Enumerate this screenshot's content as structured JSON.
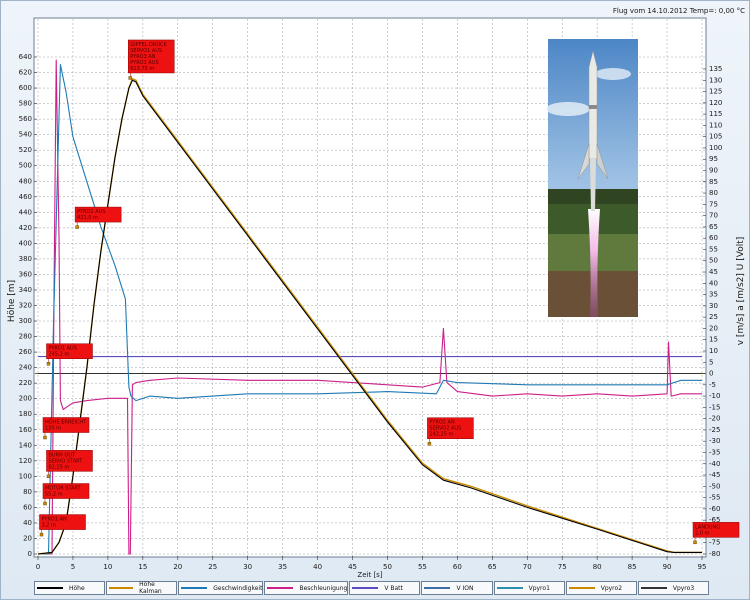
{
  "header": {
    "flight_info": "Flug vom 14.10.2012 Temp=: 0,00 °C"
  },
  "chart_data": {
    "type": "line",
    "xlabel": "Zeit [s]",
    "ylabel_left": "Höhe [m]",
    "ylabel_right": "v [m/s]  a [m/s2]  U [Volt]",
    "xlim": [
      0,
      95
    ],
    "x_ticks": [
      0,
      5,
      10,
      15,
      20,
      25,
      30,
      35,
      40,
      45,
      50,
      55,
      60,
      65,
      70,
      75,
      80,
      85,
      90,
      95
    ],
    "ylim_left": [
      0,
      640
    ],
    "y_ticks_left": [
      0,
      20,
      40,
      60,
      80,
      100,
      120,
      140,
      160,
      180,
      200,
      220,
      240,
      260,
      280,
      300,
      320,
      340,
      360,
      380,
      400,
      420,
      440,
      460,
      480,
      500,
      520,
      540,
      560,
      580,
      600,
      620,
      640
    ],
    "ylim_right": [
      -80,
      135
    ],
    "y_ticks_right": [
      -80,
      -75,
      -70,
      -65,
      -60,
      -55,
      -50,
      -45,
      -40,
      -35,
      -30,
      -25,
      -20,
      -15,
      -10,
      -5,
      0,
      5,
      10,
      15,
      20,
      25,
      30,
      35,
      40,
      45,
      50,
      55,
      60,
      65,
      70,
      75,
      80,
      85,
      90,
      95,
      100,
      105,
      110,
      115,
      120,
      125,
      130,
      135
    ],
    "grid": true,
    "legend_position": "bottom",
    "series": [
      {
        "name": "Höhe",
        "color": "#000000",
        "axis": "left",
        "x": [
          0,
          2,
          3,
          4,
          5,
          6,
          7,
          8,
          9,
          10,
          11,
          12,
          13,
          13.5,
          14,
          15,
          20,
          30,
          40,
          50,
          55,
          58,
          62,
          70,
          80,
          90,
          91,
          92,
          95
        ],
        "y": [
          0,
          2,
          15,
          40,
          100,
          170,
          240,
          320,
          390,
          450,
          510,
          560,
          600,
          610,
          608,
          590,
          530,
          410,
          290,
          170,
          115,
          95,
          85,
          60,
          32,
          3,
          2,
          2,
          2
        ]
      },
      {
        "name": "Höhe Kalman",
        "color": "#c98a00",
        "axis": "left",
        "x": [
          0,
          2,
          3,
          4,
          5,
          6,
          7,
          8,
          9,
          10,
          11,
          12,
          13,
          13.5,
          14,
          15,
          20,
          30,
          40,
          50,
          55,
          58,
          62,
          70,
          80,
          90,
          91,
          92,
          95
        ],
        "y": [
          0,
          2,
          15,
          40,
          100,
          170,
          240,
          320,
          390,
          450,
          510,
          560,
          600,
          612,
          610,
          592,
          532,
          412,
          292,
          172,
          117,
          97,
          87,
          62,
          33,
          4,
          2,
          2,
          2
        ]
      },
      {
        "name": "Geschwindigkeit",
        "color": "#1f7ab5",
        "axis": "right",
        "x": [
          0,
          1.5,
          2.2,
          3.2,
          4,
          5,
          7,
          9,
          11,
          12.5,
          13,
          13.3,
          14,
          16,
          20,
          30,
          40,
          50,
          57,
          58,
          60,
          70,
          80,
          90,
          92,
          95
        ],
        "y": [
          -80,
          -80,
          20,
          137,
          125,
          105,
          85,
          65,
          48,
          33,
          -6,
          -10,
          -12,
          -10,
          -11,
          -9,
          -9,
          -8,
          -9,
          -3,
          -4,
          -5,
          -5,
          -5,
          -3,
          -3
        ]
      },
      {
        "name": "Beschleunigung",
        "color": "#cc1f8a",
        "axis": "right",
        "x": [
          0,
          2,
          2.3,
          2.6,
          3,
          3.2,
          3.6,
          4,
          5,
          7,
          10,
          12.8,
          13,
          13.2,
          13.5,
          14,
          16,
          20,
          30,
          40,
          50,
          55,
          57.5,
          58,
          58.5,
          60,
          65,
          70,
          75,
          80,
          85,
          90,
          90.2,
          90.6,
          92,
          95
        ],
        "y": [
          -80,
          -80,
          40,
          139,
          60,
          -12,
          -16,
          -15,
          -13,
          -12,
          -11,
          -11,
          -80,
          -80,
          -5,
          -4,
          -3,
          -2,
          -3,
          -3,
          -5,
          -6,
          -4,
          20,
          -4,
          -8,
          -10,
          -9,
          -10,
          -9,
          -10,
          -9,
          14,
          -10,
          -9,
          -9
        ]
      },
      {
        "name": "V Batt",
        "color": "#5b4cc4",
        "axis": "right",
        "x": [
          0,
          95
        ],
        "y": [
          7.5,
          7.5
        ]
      },
      {
        "name": "V ION",
        "color": "#3b6ea8",
        "axis": "right",
        "x": [
          0,
          95
        ],
        "y": [
          0,
          0
        ]
      },
      {
        "name": "Vpyro1",
        "color": "#2e8fb0",
        "axis": "right",
        "x": [
          0,
          95
        ],
        "y": [
          0,
          0
        ]
      },
      {
        "name": "Vpyro2",
        "color": "#c98a00",
        "axis": "right",
        "x": [
          0,
          95
        ],
        "y": [
          0,
          0
        ]
      },
      {
        "name": "Vpyro3",
        "color": "#333333",
        "axis": "right",
        "x": [
          0,
          95
        ],
        "y": [
          0,
          0
        ]
      }
    ],
    "annotations": [
      {
        "text": "GIPFEL DRUCK / SERVO1 AUS / PYRO3 AN / PYRO1 AUS / 613,75 m",
        "x": 13.2,
        "y": 613
      },
      {
        "text": "PYRO2 AUS / 421,5 m",
        "x": 5.6,
        "y": 421
      },
      {
        "text": "PYRO1 AUS / 245,2 m",
        "x": 1.5,
        "y": 245
      },
      {
        "text": "HÖHE ERREICHT / 130 m",
        "x": 1,
        "y": 150
      },
      {
        "text": "BURN OUT / SERVO START / 82,25 m",
        "x": 1.5,
        "y": 100
      },
      {
        "text": "MOTOR START / 55,2 m",
        "x": 1,
        "y": 65
      },
      {
        "text": "PYRO1 AN / 3,2 m",
        "x": 0.5,
        "y": 25
      },
      {
        "text": "PYRO2 AN / SERVO2 AUS / 142,25 m",
        "x": 56,
        "y": 142
      },
      {
        "text": "LANDUNG / 2,0 m",
        "x": 94,
        "y": 15
      }
    ]
  },
  "legend_items": [
    "Höhe",
    "Höhe Kalman",
    "Geschwindigkeit",
    "Beschleunigung",
    "V Batt",
    "V ION",
    "Vpyro1",
    "Vpyro2",
    "Vpyro3"
  ]
}
